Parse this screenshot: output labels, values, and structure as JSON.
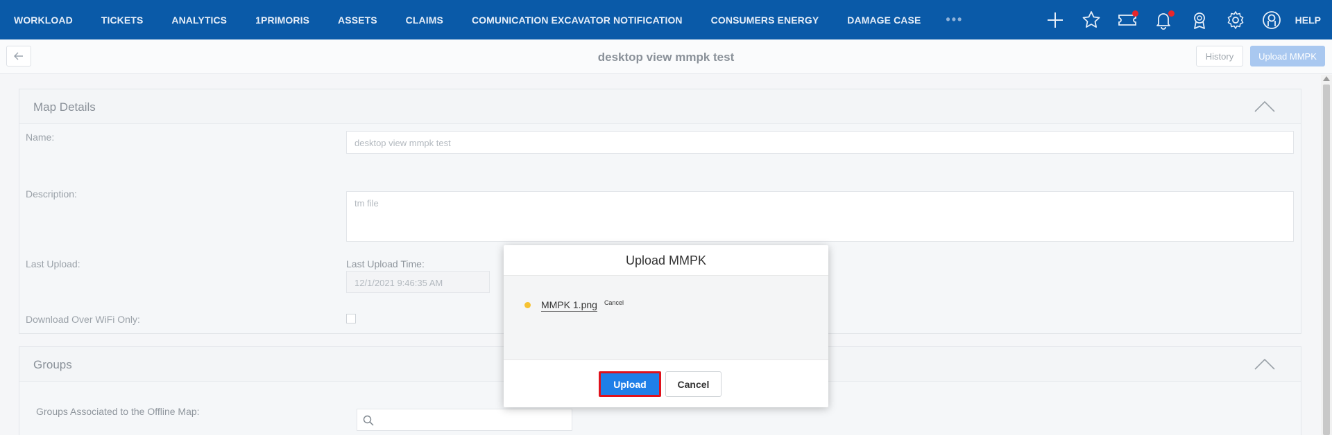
{
  "nav": {
    "items": [
      "WORKLOAD",
      "TICKETS",
      "ANALYTICS",
      "1PRIMORIS",
      "ASSETS",
      "CLAIMS",
      "COMUNICATION EXCAVATOR NOTIFICATION",
      "CONSUMERS ENERGY",
      "DAMAGE CASE"
    ],
    "more": "•••",
    "help": "HELP"
  },
  "header": {
    "title": "desktop view mmpk test",
    "history_label": "History",
    "upload_label": "Upload MMPK"
  },
  "map_details": {
    "title": "Map Details",
    "name_label": "Name:",
    "name_value": "desktop view mmpk test",
    "description_label": "Description:",
    "description_value": "tm file",
    "last_upload_label": "Last Upload:",
    "last_upload_time_label": "Last Upload Time:",
    "last_upload_time_value": "12/1/2021 9:46:35 AM",
    "wifi_label": "Download Over WiFi Only:"
  },
  "groups": {
    "title": "Groups",
    "associated_label": "Groups Associated to the Offline Map:"
  },
  "modal": {
    "title": "Upload MMPK",
    "file_name": "MMPK 1.png",
    "file_cancel": "Cancel",
    "upload_label": "Upload",
    "cancel_label": "Cancel"
  }
}
